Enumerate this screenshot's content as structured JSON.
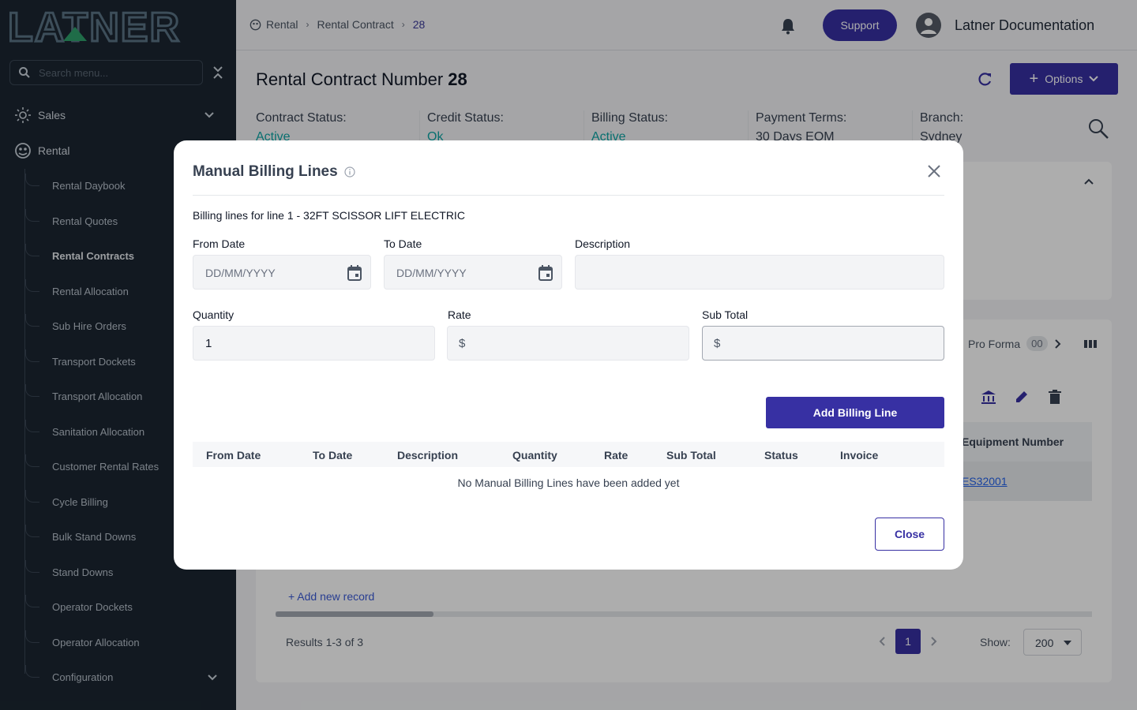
{
  "app": {
    "logo_text": "LATNER"
  },
  "sidebar": {
    "search_placeholder": "Search menu...",
    "sections": [
      {
        "label": "Sales"
      },
      {
        "label": "Rental"
      }
    ],
    "items": [
      {
        "label": "Rental Daybook"
      },
      {
        "label": "Rental Quotes"
      },
      {
        "label": "Rental Contracts",
        "active": true
      },
      {
        "label": "Rental Allocation"
      },
      {
        "label": "Sub Hire Orders"
      },
      {
        "label": "Transport Dockets"
      },
      {
        "label": "Transport Allocation"
      },
      {
        "label": "Sanitation Allocation"
      },
      {
        "label": "Customer Rental Rates"
      },
      {
        "label": "Cycle Billing"
      },
      {
        "label": "Bulk Stand Downs"
      },
      {
        "label": "Stand Downs"
      },
      {
        "label": "Operator Dockets"
      },
      {
        "label": "Operator Allocation"
      },
      {
        "label": "Configuration"
      }
    ]
  },
  "header": {
    "breadcrumb": [
      "Rental",
      "Rental Contract",
      "28"
    ],
    "support_label": "Support",
    "user_name": "Latner Documentation"
  },
  "page": {
    "title": "Rental Contract Number",
    "number": "28",
    "options_label": "Options",
    "status": [
      {
        "label": "Contract Status:",
        "value": "Active"
      },
      {
        "label": "Credit Status:",
        "value": "Ok"
      },
      {
        "label": "Billing Status:",
        "value": "Active"
      },
      {
        "label": "Payment Terms:",
        "value": "30 Days EOM"
      },
      {
        "label": "Branch:",
        "value": "Sydney"
      }
    ],
    "pro_forma_label": "Pro Forma",
    "pro_forma_badge": "00",
    "equipment_header": "Equipment Number",
    "equipment_value": "ES32001",
    "add_record": "+ Add new record",
    "results": "Results 1-3 of 3",
    "current_page": "1",
    "show_label": "Show:",
    "show_value": "200"
  },
  "modal": {
    "title": "Manual Billing Lines",
    "subtitle": "Billing lines for line 1 - 32FT SCISSOR LIFT ELECTRIC",
    "from_date_label": "From Date",
    "from_date_placeholder": "DD/MM/YYYY",
    "to_date_label": "To Date",
    "to_date_placeholder": "DD/MM/YYYY",
    "description_label": "Description",
    "description_value": "",
    "quantity_label": "Quantity",
    "quantity_value": "1",
    "rate_label": "Rate",
    "currency": "$",
    "sub_total_label": "Sub Total",
    "add_button": "Add Billing Line",
    "columns": [
      "From Date",
      "To Date",
      "Description",
      "Quantity",
      "Rate",
      "Sub Total",
      "Status",
      "Invoice"
    ],
    "empty_message": "No Manual Billing Lines have been added yet",
    "close_button": "Close"
  },
  "colors": {
    "primary": "#3730a3",
    "sidebar_bg": "#1b2631",
    "status_teal": "#0ea5a5"
  }
}
